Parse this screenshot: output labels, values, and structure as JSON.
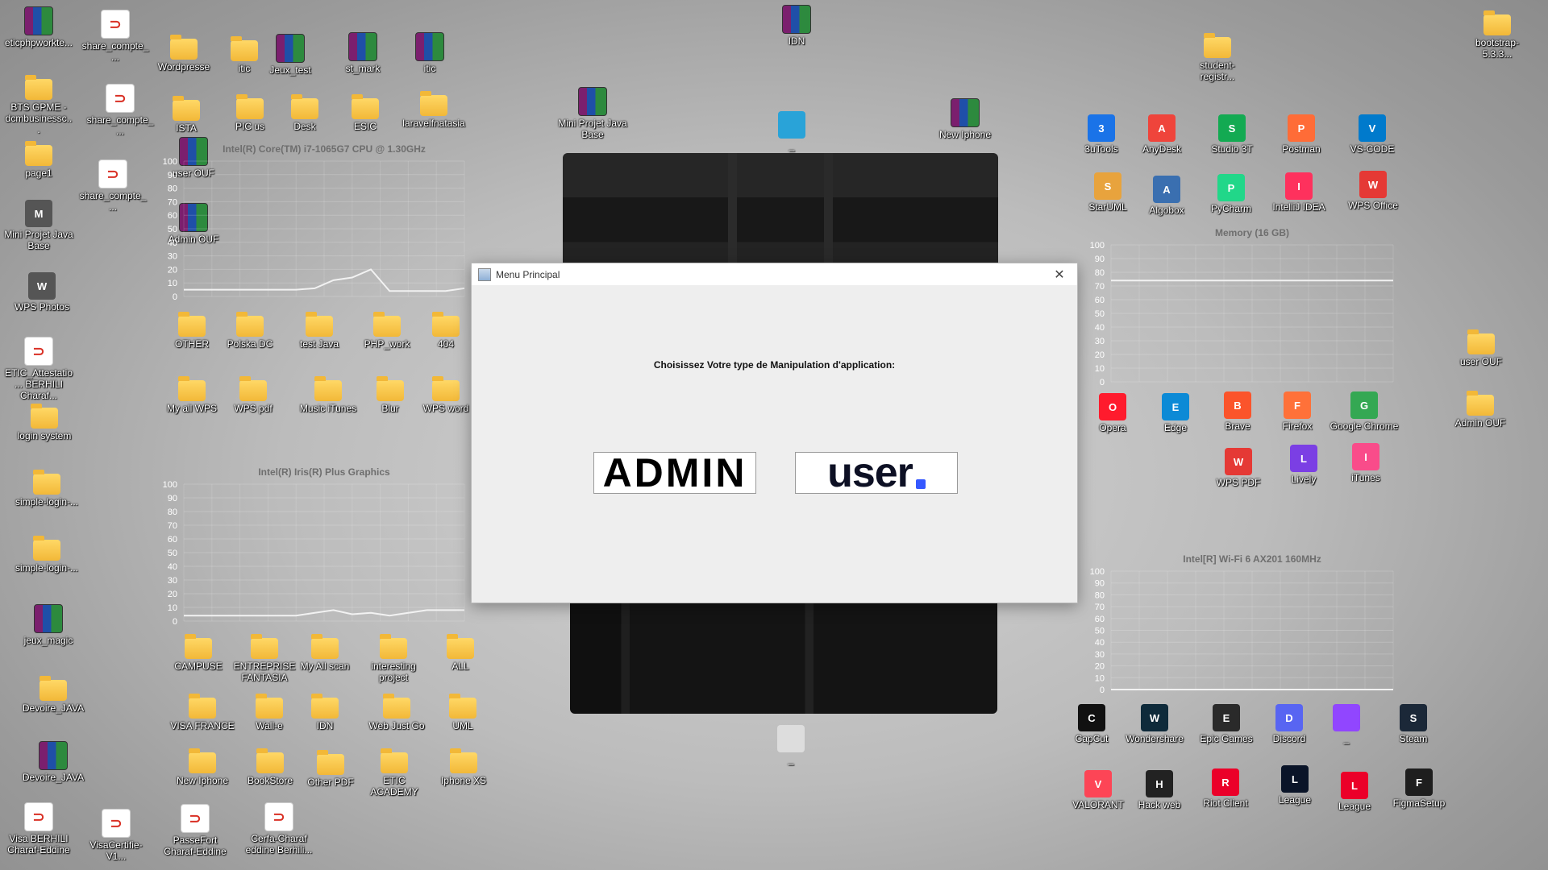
{
  "desktop": {
    "icons": [
      {
        "label": "eticphpworkte...",
        "type": "rar"
      },
      {
        "label": "share_compte_...",
        "type": "pdf"
      },
      {
        "label": "Wordpresse",
        "type": "folder"
      },
      {
        "label": "itic",
        "type": "folder"
      },
      {
        "label": "Jeux_test",
        "type": "rar"
      },
      {
        "label": "st_mark",
        "type": "rar"
      },
      {
        "label": "itic",
        "type": "rar"
      },
      {
        "label": "IDN",
        "type": "rar"
      },
      {
        "label": "bootstrap-5.3.3...",
        "type": "folder"
      },
      {
        "label": "student-registr...",
        "type": "folder"
      },
      {
        "label": "BTS GPME - dcmbusinessc...",
        "type": "folder"
      },
      {
        "label": "share_compte_...",
        "type": "pdf"
      },
      {
        "label": "ISTA",
        "type": "folder"
      },
      {
        "label": "PIC us",
        "type": "folder"
      },
      {
        "label": "Desk",
        "type": "folder"
      },
      {
        "label": "ESIC",
        "type": "folder"
      },
      {
        "label": "laravelfnatasia",
        "type": "folder"
      },
      {
        "label": "Mini Projet Java Base",
        "type": "rar"
      },
      {
        "label": "New Iphone",
        "type": "rar"
      },
      {
        "label": "page1",
        "type": "folder"
      },
      {
        "label": "share_compte_...",
        "type": "pdf"
      },
      {
        "label": "user OUF",
        "type": "rar"
      },
      {
        "label": "Admin OUF",
        "type": "rar"
      },
      {
        "label": "Mini Projet Java Base",
        "type": "app"
      },
      {
        "label": "WPS Photos",
        "type": "app"
      },
      {
        "label": "ETIC_Attestatio... BERHILI Charaf...",
        "type": "pdf"
      },
      {
        "label": "login system",
        "type": "folder"
      },
      {
        "label": "simple-login-...",
        "type": "folder"
      },
      {
        "label": "simple-login-...",
        "type": "folder"
      },
      {
        "label": "jeux_magic",
        "type": "rar"
      },
      {
        "label": "Devoire_JAVA",
        "type": "folder"
      },
      {
        "label": "Devoire_JAVA",
        "type": "rar"
      },
      {
        "label": "Visa BERHILI Charaf-Eddine",
        "type": "pdf"
      },
      {
        "label": "VisaCertifie-V1...",
        "type": "pdf"
      },
      {
        "label": "PasseFort Charaf-Eddine",
        "type": "pdf"
      },
      {
        "label": "Cerfa-Charaf eddine Berhili...",
        "type": "pdf"
      },
      {
        "label": "OTHER",
        "type": "folder"
      },
      {
        "label": "Polska DC",
        "type": "folder"
      },
      {
        "label": "test Java",
        "type": "folder"
      },
      {
        "label": "PHP_work",
        "type": "folder"
      },
      {
        "label": "404",
        "type": "folder"
      },
      {
        "label": "My all WPS",
        "type": "folder"
      },
      {
        "label": "WPS pdf",
        "type": "folder"
      },
      {
        "label": "Music iTunes",
        "type": "folder"
      },
      {
        "label": "Blur",
        "type": "folder"
      },
      {
        "label": "WPS word",
        "type": "folder"
      },
      {
        "label": "CAMPUSE",
        "type": "folder"
      },
      {
        "label": "ENTREPRISE FANTASIA",
        "type": "folder"
      },
      {
        "label": "My All scan",
        "type": "folder"
      },
      {
        "label": "interesting project",
        "type": "folder"
      },
      {
        "label": "ALL",
        "type": "folder"
      },
      {
        "label": "VISA FRANCE",
        "type": "folder"
      },
      {
        "label": "Wall-e",
        "type": "folder"
      },
      {
        "label": "IDN",
        "type": "folder"
      },
      {
        "label": "Web Just Go",
        "type": "folder"
      },
      {
        "label": "UML",
        "type": "folder"
      },
      {
        "label": "New Iphone",
        "type": "folder"
      },
      {
        "label": "BookStore",
        "type": "folder"
      },
      {
        "label": "Other PDF",
        "type": "folder"
      },
      {
        "label": "ETIC ACADEMY",
        "type": "folder"
      },
      {
        "label": "Iphone XS",
        "type": "folder"
      },
      {
        "label": "3uTools",
        "type": "app",
        "color": "#1a73e8"
      },
      {
        "label": "AnyDesk",
        "type": "app",
        "color": "#ef443b"
      },
      {
        "label": "Studio 3T",
        "type": "app",
        "color": "#13aa52"
      },
      {
        "label": "Postman",
        "type": "app",
        "color": "#ff6c37"
      },
      {
        "label": "VS-CODE",
        "type": "app",
        "color": "#007acc"
      },
      {
        "label": "StarUML",
        "type": "app",
        "color": "#e8a33d"
      },
      {
        "label": "Algobox",
        "type": "app",
        "color": "#3a6fb0"
      },
      {
        "label": "PyCharm",
        "type": "app",
        "color": "#21d789"
      },
      {
        "label": "IntelliJ IDEA",
        "type": "app",
        "color": "#fe315d"
      },
      {
        "label": "WPS Office",
        "type": "app",
        "color": "#e53935"
      },
      {
        "label": "Opera",
        "type": "app",
        "color": "#ff1b2d"
      },
      {
        "label": "Edge",
        "type": "app",
        "color": "#0c8ad6"
      },
      {
        "label": "Brave",
        "type": "app",
        "color": "#fb542b"
      },
      {
        "label": "Firefox",
        "type": "app",
        "color": "#ff7139"
      },
      {
        "label": "Google Chrome",
        "type": "app",
        "color": "#34a853"
      },
      {
        "label": "WPS PDF",
        "type": "app",
        "color": "#e53935"
      },
      {
        "label": "Lively",
        "type": "app",
        "color": "#7b3fe4"
      },
      {
        "label": "iTunes",
        "type": "app",
        "color": "#f94c8a"
      },
      {
        "label": "user OUF",
        "type": "folder"
      },
      {
        "label": "Admin OUF",
        "type": "folder"
      },
      {
        "label": "CapCut",
        "type": "app",
        "color": "#111111"
      },
      {
        "label": "Wondershare",
        "type": "app",
        "color": "#0e2a3a"
      },
      {
        "label": "Epic Games",
        "type": "app",
        "color": "#2a2a2a"
      },
      {
        "label": "Discord",
        "type": "app",
        "color": "#5865f2"
      },
      {
        "label": "_",
        "type": "app",
        "color": "#9146ff"
      },
      {
        "label": "Steam",
        "type": "app",
        "color": "#1b2838"
      },
      {
        "label": "VALORANT",
        "type": "app",
        "color": "#fd4556"
      },
      {
        "label": "Hack web",
        "type": "app",
        "color": "#222222"
      },
      {
        "label": "Riot Client",
        "type": "app",
        "color": "#eb0029"
      },
      {
        "label": "League",
        "type": "app",
        "color": "#0a1428"
      },
      {
        "label": "League",
        "type": "app",
        "color": "#eb0029"
      },
      {
        "label": "FigmaSetup",
        "type": "app",
        "color": "#1e1e1e"
      },
      {
        "label": "_",
        "type": "app",
        "color": "#29a3d8"
      },
      {
        "label": "_",
        "type": "app",
        "color": "#dddddd"
      }
    ]
  },
  "widgets": {
    "cpu": {
      "title": "Intel(R) Core(TM) i7-1065G7 CPU @ 1.30GHz",
      "ticks": [
        "100",
        "90",
        "80",
        "70",
        "60",
        "50",
        "40",
        "30",
        "20",
        "10",
        "0"
      ],
      "usage": [
        5,
        5,
        5,
        5,
        5,
        5,
        5,
        6,
        12,
        14,
        20,
        4,
        4,
        4,
        4,
        6
      ]
    },
    "gpu": {
      "title": "Intel(R) Iris(R) Plus Graphics",
      "ticks": [
        "100",
        "90",
        "80",
        "70",
        "60",
        "50",
        "40",
        "30",
        "20",
        "10",
        "0"
      ],
      "usage": [
        4,
        4,
        4,
        4,
        4,
        4,
        4,
        6,
        8,
        5,
        6,
        4,
        6,
        8,
        8,
        8
      ]
    },
    "memory": {
      "title": "Memory (16 GB)",
      "ticks": [
        "100",
        "90",
        "80",
        "70",
        "60",
        "50",
        "40",
        "30",
        "20",
        "10",
        "0"
      ],
      "usage": [
        74,
        74,
        74,
        74,
        74,
        74,
        74,
        74,
        74,
        74,
        74,
        74,
        74,
        74,
        74,
        74
      ]
    },
    "wifi": {
      "title": "Intel[R] Wi-Fi 6 AX201 160MHz",
      "ticks": [
        "100",
        "90",
        "80",
        "70",
        "60",
        "50",
        "40",
        "30",
        "20",
        "10",
        "0"
      ],
      "usage": [
        0,
        0,
        0,
        0,
        0,
        0,
        0,
        0,
        0,
        0,
        0,
        0,
        0,
        0,
        0,
        0
      ]
    }
  },
  "dialog": {
    "title": "Menu Principal",
    "close": "✕",
    "prompt": "Choisissez Votre type de Manipulation d'application:",
    "admin_button": "ADMIN",
    "user_button": "user"
  }
}
